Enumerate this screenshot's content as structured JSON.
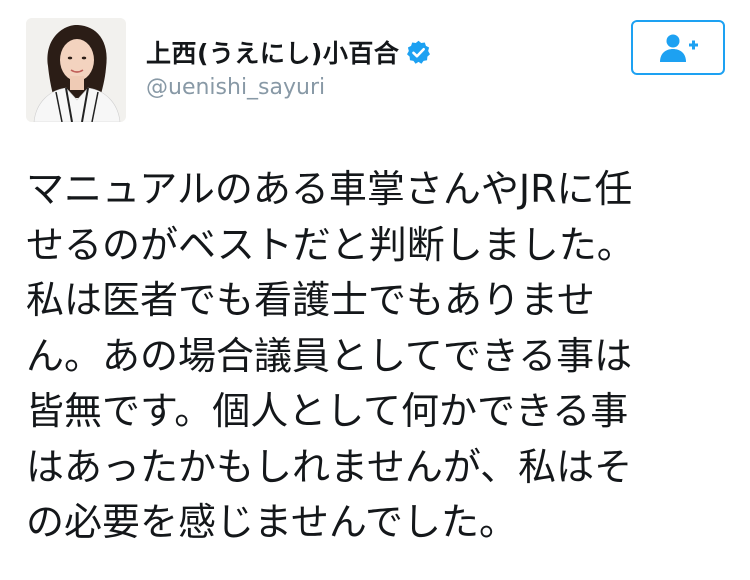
{
  "profile": {
    "display_name": "上西(うえにし)小百合",
    "handle": "@uenishi_sayuri",
    "verified": true,
    "verified_icon": "verified-badge-icon",
    "avatar_icon": "profile-photo"
  },
  "follow_button": {
    "icon": "add-user-icon"
  },
  "tweet": {
    "lines": [
      "マニュアルのある車掌さんやJRに任",
      "せるのがベストだと判断しました。",
      "私は医者でも看護士でもありませ",
      "ん。あの場合議員としてできる事は",
      "皆無です。個人として何かできる事",
      "はあったかもしれませんが、私はそ",
      "の必要を感じませんでした。"
    ]
  },
  "colors": {
    "accent": "#1da1f2",
    "text": "#14171a",
    "secondary_text": "#8899a6",
    "background": "#ffffff"
  }
}
